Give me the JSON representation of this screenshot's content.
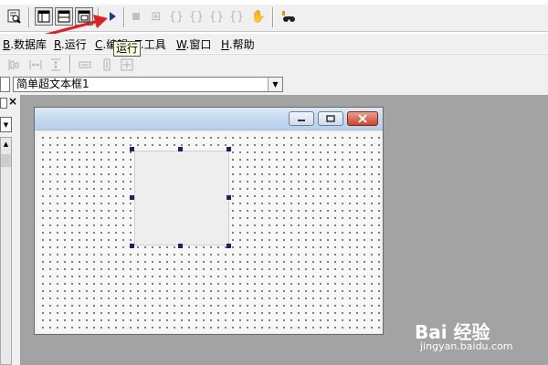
{
  "menu": {
    "items": [
      {
        "key": "B",
        "label": ".数据库"
      },
      {
        "key": "R",
        "label": ".运行"
      },
      {
        "key": "C",
        "label": ".编辑"
      },
      {
        "key": "T",
        "label": ".工具"
      },
      {
        "key": "W",
        "label": ".窗口"
      },
      {
        "key": "H",
        "label": ".帮助"
      }
    ]
  },
  "tooltip": {
    "text": "运行"
  },
  "combo": {
    "value": "简单超文本框1"
  },
  "left_panel": {
    "close_label": "×"
  },
  "watermark": {
    "logo": "Bai 经验",
    "url": "jingyan.baidu.com"
  },
  "colors": {
    "workspace": "#a3a3a3",
    "arrow": "#e02020",
    "run": "#1a3c8a",
    "handle": "#1f1f6e",
    "close": "#c8452e"
  },
  "icons": [
    "preview-icon",
    "grid-layout-icon",
    "grid-layout-icon-2",
    "grid-layout-icon-3",
    "run-icon",
    "stop-icon",
    "step-icon",
    "find-icon"
  ]
}
